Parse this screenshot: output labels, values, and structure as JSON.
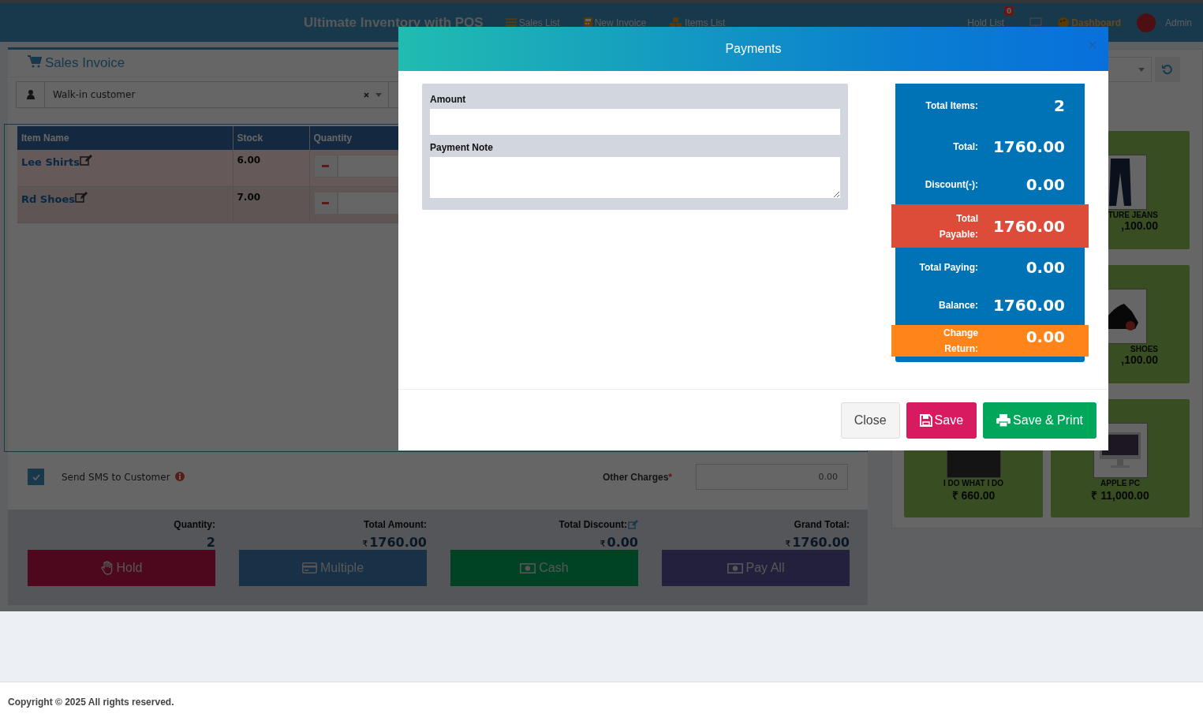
{
  "navbar": {
    "title": "Ultimate Inventory with POS",
    "links": [
      {
        "label": "Sales List",
        "kind": "list"
      },
      {
        "label": "New Invoice",
        "kind": "calculator"
      },
      {
        "label": "Items List",
        "kind": "cubes"
      }
    ],
    "hold_list": {
      "label": "Hold List",
      "badge": "0"
    },
    "dashboard": "Dashboard",
    "user": "Admin"
  },
  "sales_invoice": {
    "title": "Sales Invoice",
    "customer": "Walk-in customer",
    "table": {
      "columns": [
        "Item Name",
        "Stock",
        "Quantity"
      ],
      "rows": [
        {
          "item": "Lee Shirts",
          "stock": "6.00"
        },
        {
          "item": "Rd Shoes",
          "stock": "7.00"
        }
      ]
    },
    "send_sms": {
      "label": "Send SMS to Customer",
      "checked": true
    },
    "other_charges": {
      "label": "Other Charges",
      "mark": "*",
      "value": "0.00"
    },
    "summary": [
      {
        "label": "Quantity:",
        "value": "2",
        "kind": "plain"
      },
      {
        "label": "Total Amount:",
        "currency": "₹",
        "value": "1760.00",
        "kind": "plain"
      },
      {
        "label": "Total Discount:",
        "currency": "₹",
        "value": "0.00",
        "kind": "editable"
      },
      {
        "label": "Grand Total:",
        "currency": "₹",
        "value": "1760.00",
        "kind": "plain"
      }
    ],
    "actions": [
      {
        "label": "Hold",
        "kind": "hold"
      },
      {
        "label": "Multiple",
        "kind": "multiple"
      },
      {
        "label": "Cash",
        "kind": "cash"
      },
      {
        "label": "Pay All",
        "kind": "payall"
      }
    ]
  },
  "products": [
    {
      "name": "TURE JEANS",
      "price": ",100.00",
      "kind": "covered"
    },
    {
      "name": "SHOES",
      "price": ",100.00",
      "kind": "covered"
    },
    {
      "name": "I DO WHAT I DO",
      "price": "₹ 660.00",
      "kind": "full"
    },
    {
      "name": "APPLE PC",
      "price": "₹ 11,000.00",
      "kind": "full"
    }
  ],
  "modal": {
    "title": "Payments",
    "fields": [
      {
        "label": "Amount",
        "kind": "input"
      },
      {
        "label": "Payment Note",
        "kind": "textarea"
      }
    ],
    "stats": [
      {
        "label": "Total Items:",
        "value": "2",
        "kind": "normal"
      },
      {
        "label": "Total:",
        "value": "1760.00",
        "kind": "normal"
      },
      {
        "label": "Discount(-):",
        "value": "0.00",
        "kind": "normal"
      },
      {
        "label": "Total Payable:",
        "value": "1760.00",
        "kind": "payable"
      },
      {
        "label": "Total Paying:",
        "value": "0.00",
        "kind": "normal"
      },
      {
        "label": "Balance:",
        "value": "1760.00",
        "kind": "normal"
      },
      {
        "label": "Change Return:",
        "value": "0.00",
        "kind": "change"
      }
    ],
    "buttons": [
      {
        "label": "Close",
        "kind": "close"
      },
      {
        "label": "Save",
        "kind": "save"
      },
      {
        "label": "Save & Print",
        "kind": "print"
      }
    ]
  },
  "footer": "Copyright © 2025 All rights reserved."
}
